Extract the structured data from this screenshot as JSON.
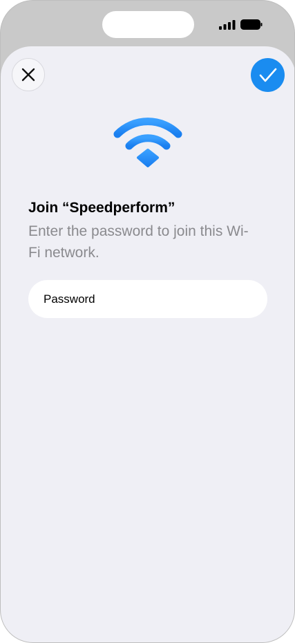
{
  "status_bar": {
    "signal_icon": "cellular-signal-icon",
    "battery_icon": "battery-full-icon"
  },
  "header": {
    "close_icon": "close-icon",
    "confirm_icon": "checkmark-icon"
  },
  "network": {
    "icon": "wifi-icon",
    "title": "Join “Speedperform”",
    "subtitle": "Enter the password to join this Wi-Fi network."
  },
  "form": {
    "password_placeholder": "Password",
    "password_value": ""
  },
  "colors": {
    "accent": "#1a8cf0",
    "wifi_top": "#3aa0ff",
    "wifi_bottom": "#1a7ff0",
    "sheet_background": "#efeff5",
    "secondary_text": "#8a8a8e"
  }
}
